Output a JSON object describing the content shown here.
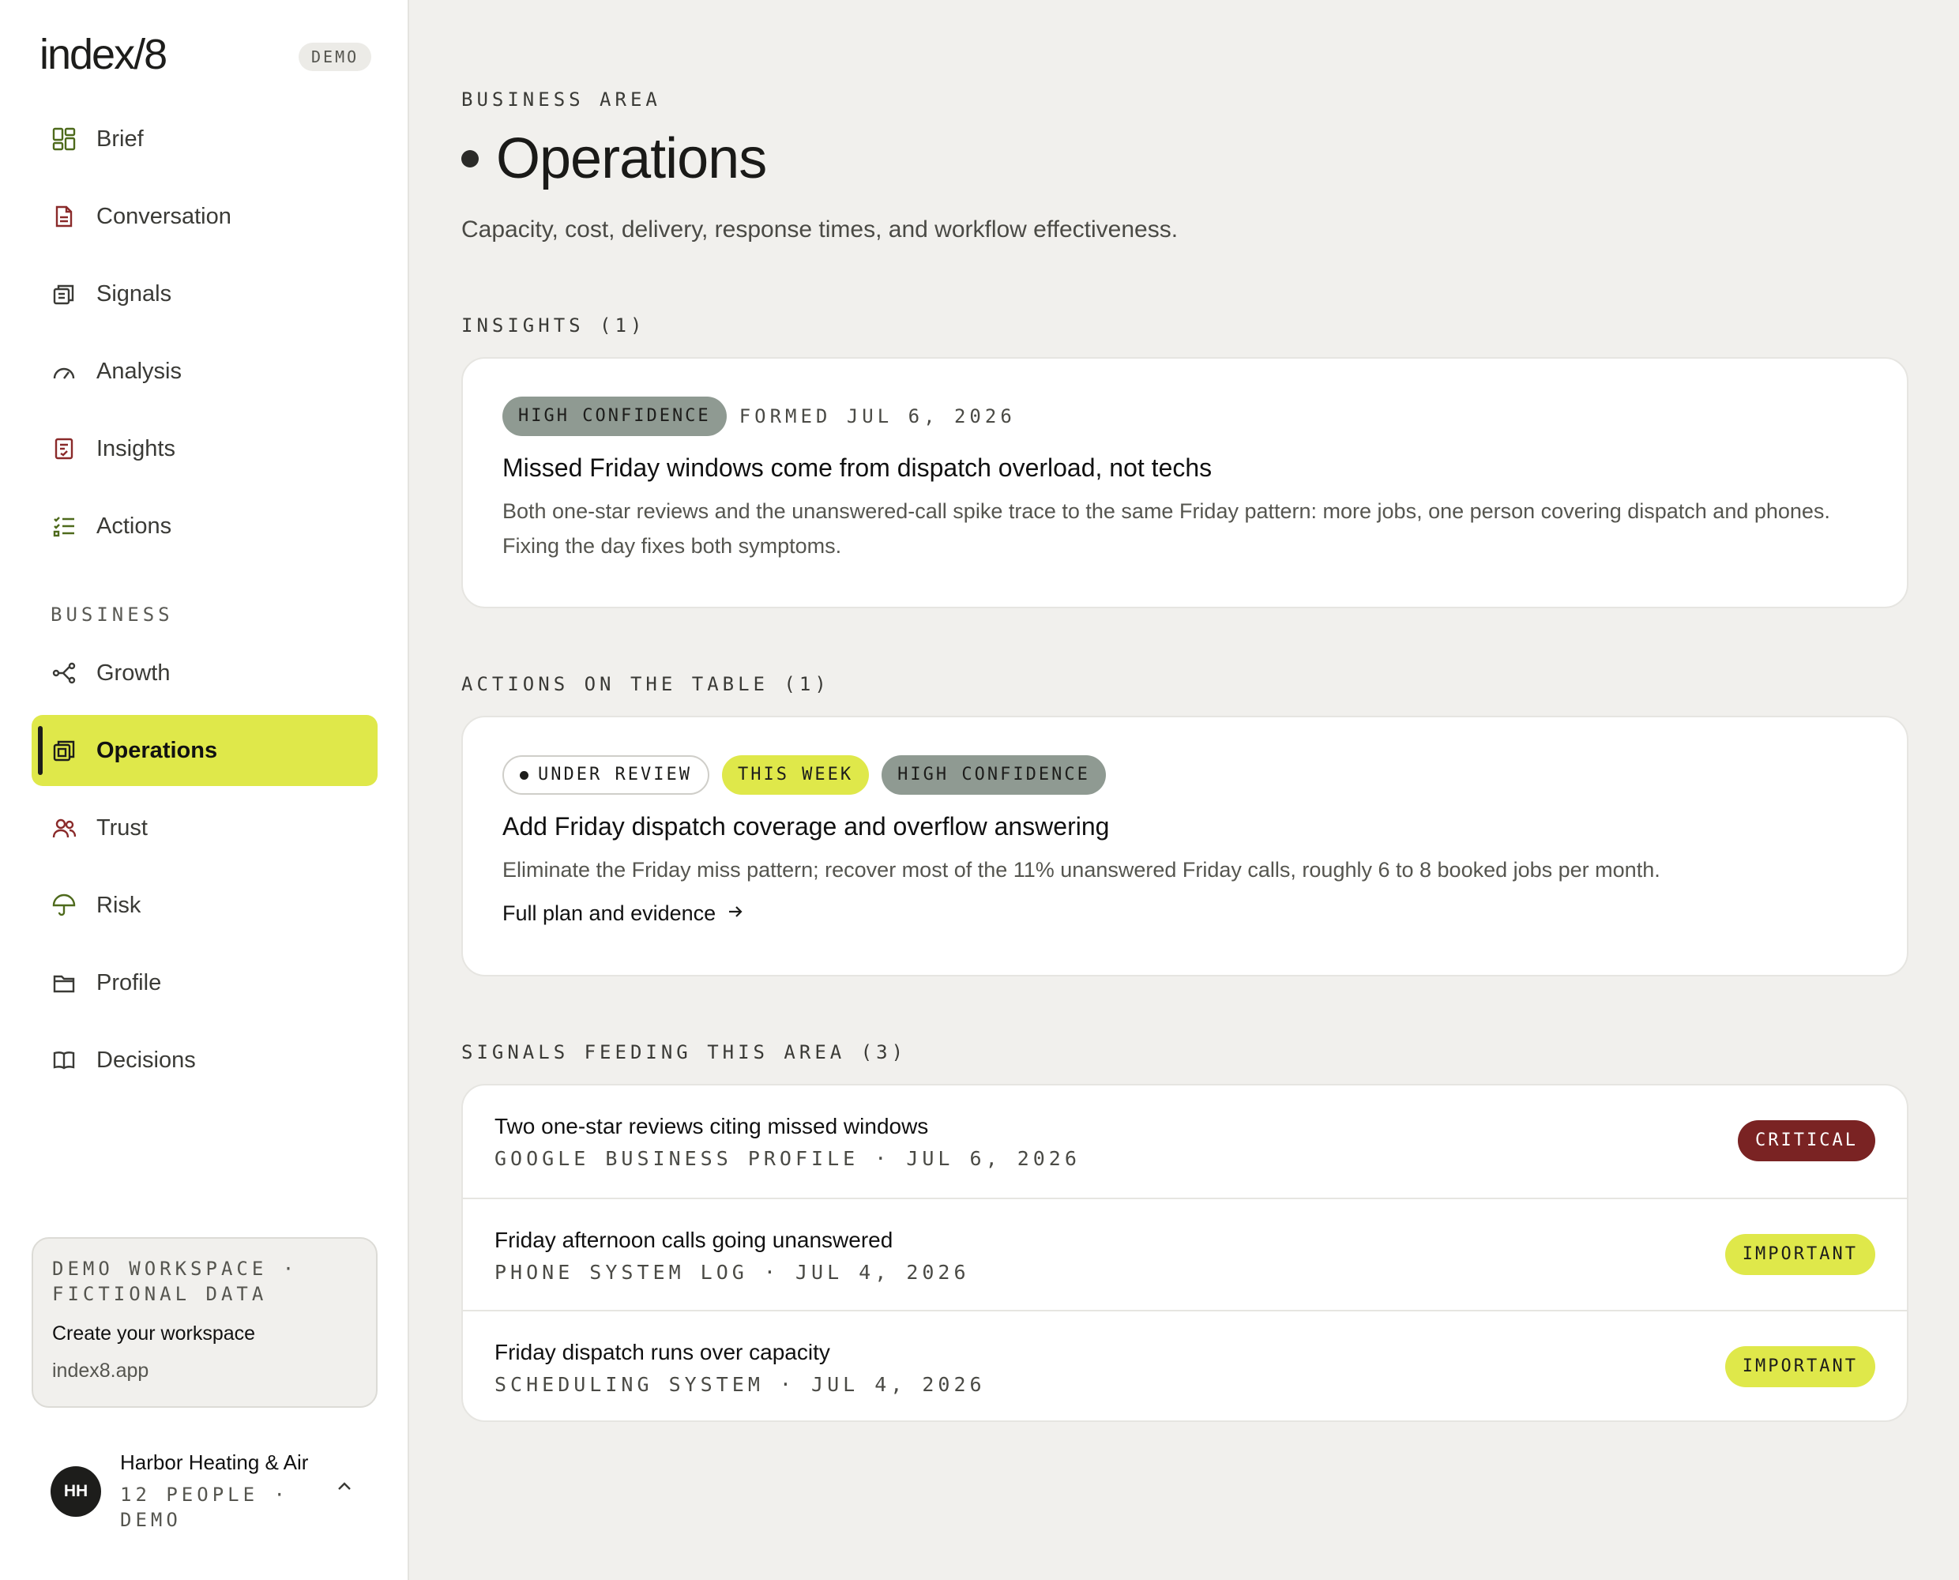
{
  "app": {
    "logo": "index/8",
    "demo_badge": "DEMO"
  },
  "sidebar": {
    "items": [
      {
        "label": "Brief",
        "icon": "grid-icon"
      },
      {
        "label": "Conversation",
        "icon": "document-icon"
      },
      {
        "label": "Signals",
        "icon": "stack-icon"
      },
      {
        "label": "Analysis",
        "icon": "gauge-icon"
      },
      {
        "label": "Insights",
        "icon": "note-icon"
      },
      {
        "label": "Actions",
        "icon": "checklist-icon"
      }
    ],
    "section_label": "BUSINESS",
    "business_items": [
      {
        "label": "Growth",
        "icon": "share-icon"
      },
      {
        "label": "Operations",
        "icon": "layers-icon",
        "active": true
      },
      {
        "label": "Trust",
        "icon": "people-icon"
      },
      {
        "label": "Risk",
        "icon": "umbrella-icon"
      },
      {
        "label": "Profile",
        "icon": "folder-icon"
      },
      {
        "label": "Decisions",
        "icon": "book-icon"
      }
    ],
    "demo_box": {
      "title": "DEMO WORKSPACE · FICTIONAL DATA",
      "cta": "Create your workspace",
      "url": "index8.app"
    },
    "user": {
      "initials": "HH",
      "name": "Harbor Heating & Air",
      "meta": "12 PEOPLE · DEMO"
    }
  },
  "main": {
    "eyebrow": "BUSINESS AREA",
    "title": "Operations",
    "subtitle": "Capacity, cost, delivery, response times, and workflow effectiveness.",
    "insights_header": "INSIGHTS (1)",
    "insight": {
      "confidence": "HIGH CONFIDENCE",
      "formed": "FORMED JUL 6, 2026",
      "title": "Missed Friday windows come from dispatch overload, not techs",
      "body": "Both one-star reviews and the unanswered-call spike trace to the same Friday pattern: more jobs, one person covering dispatch and phones. Fixing the day fixes both symptoms."
    },
    "actions_header": "ACTIONS ON THE TABLE (1)",
    "action": {
      "status": "UNDER REVIEW",
      "timing": "THIS WEEK",
      "confidence": "HIGH CONFIDENCE",
      "title": "Add Friday dispatch coverage and overflow answering",
      "body": "Eliminate the Friday miss pattern; recover most of the 11% unanswered Friday calls, roughly 6 to 8 booked jobs per month.",
      "link": "Full plan and evidence"
    },
    "signals_header": "SIGNALS FEEDING THIS AREA (3)",
    "signals": [
      {
        "title": "Two one-star reviews citing missed windows",
        "meta": "GOOGLE BUSINESS PROFILE · JUL 6, 2026",
        "severity": "CRITICAL"
      },
      {
        "title": "Friday afternoon calls going unanswered",
        "meta": "PHONE SYSTEM LOG · JUL 4, 2026",
        "severity": "IMPORTANT"
      },
      {
        "title": "Friday dispatch runs over capacity",
        "meta": "SCHEDULING SYSTEM · JUL 4, 2026",
        "severity": "IMPORTANT"
      }
    ]
  },
  "colors": {
    "accent": "#dfe84a",
    "critical": "#7a2323",
    "confidence": "#8f9a92",
    "background": "#f1f0ed"
  }
}
